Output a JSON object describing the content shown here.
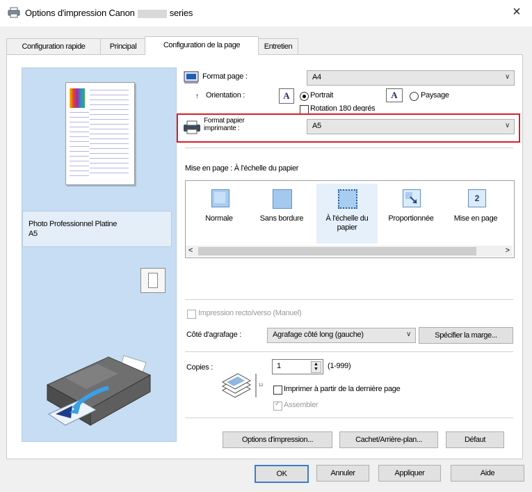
{
  "window": {
    "title_prefix": "Options d'impression Canon",
    "title_suffix": "series",
    "close_glyph": "×"
  },
  "tabs": [
    {
      "label": "Configuration rapide"
    },
    {
      "label": "Principal"
    },
    {
      "label": "Configuration de la page"
    },
    {
      "label": "Entretien"
    }
  ],
  "preview": {
    "media_info_line1": "Photo Professionnel Platine",
    "media_info_line2": "A5"
  },
  "page_size": {
    "label": "Format page :",
    "value": "A4"
  },
  "orientation": {
    "label": "Orientation :",
    "portrait": "Portrait",
    "landscape": "Paysage",
    "selected": "Portrait",
    "rotate_label": "Rotation 180 degrés"
  },
  "printer_paper": {
    "label_line1": "Format papier",
    "label_line2": "imprimante :",
    "value": "A5"
  },
  "layout": {
    "title": "Mise en page : À l'échelle du papier",
    "options": [
      {
        "label": "Normale"
      },
      {
        "label": "Sans bordure"
      },
      {
        "label": "À l'échelle du papier",
        "selected": true
      },
      {
        "label": "Proportionnée"
      },
      {
        "label": "Mise en page"
      }
    ]
  },
  "duplex": {
    "label": "Impression recto/verso (Manuel)"
  },
  "stapling": {
    "label": "Côté d'agrafage :",
    "value": "Agrafage côté long (gauche)",
    "margin_button": "Spécifier la marge..."
  },
  "copies": {
    "label": "Copies :",
    "value": "1",
    "range": "(1-999)",
    "reverse_label": "Imprimer à partir de la dernière page",
    "collate_label": "Assembler"
  },
  "bottom_buttons": {
    "print_options": "Options d'impression...",
    "stamp_background": "Cachet/Arrière-plan...",
    "defaults": "Défaut"
  },
  "dialog_buttons": {
    "ok": "OK",
    "cancel": "Annuler",
    "apply": "Appliquer",
    "help": "Aide"
  },
  "colors": {
    "highlight_box": "#e01b24",
    "preview_bg": "#c6ddf3"
  }
}
